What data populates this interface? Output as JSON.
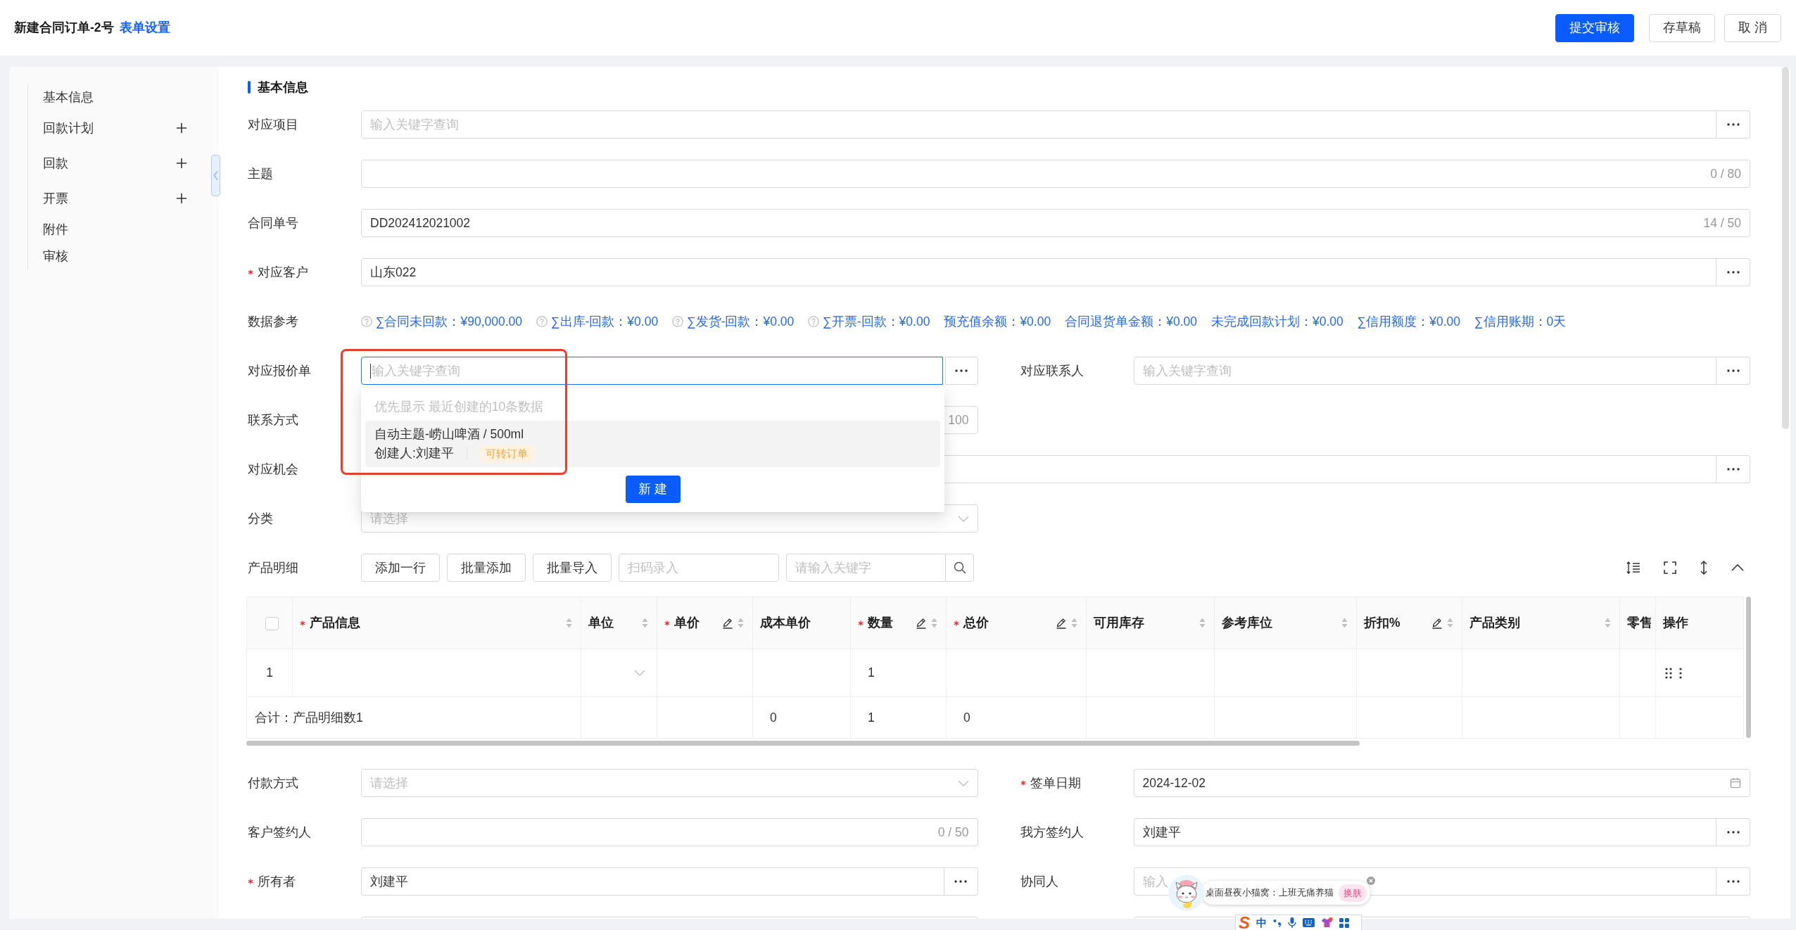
{
  "header": {
    "title": "新建合同订单-2号",
    "settings_link": "表单设置",
    "buttons": [
      {
        "label": "提交审核",
        "kind": "primary"
      },
      {
        "label": "存草稿",
        "kind": "default"
      },
      {
        "label": "取 消",
        "kind": "default"
      }
    ]
  },
  "sidebar": {
    "items": [
      {
        "label": "基本信息",
        "addable": false
      },
      {
        "label": "回款计划",
        "addable": true
      },
      {
        "label": "回款",
        "addable": true
      },
      {
        "label": "开票",
        "addable": true
      },
      {
        "label": "附件",
        "addable": false
      },
      {
        "label": "审核",
        "addable": false
      }
    ]
  },
  "section": {
    "title": "基本信息"
  },
  "form_top": [
    {
      "kind": "full",
      "field": {
        "label": "对应项目",
        "kind": "lookup",
        "required": false,
        "focused": false,
        "placeholder": "输入关键字查询"
      }
    },
    {
      "kind": "full",
      "field": {
        "label": "主题",
        "kind": "text",
        "required": false,
        "focused": false,
        "counter": "0 / 80"
      }
    },
    {
      "kind": "full",
      "field": {
        "label": "合同单号",
        "kind": "text",
        "required": false,
        "focused": false,
        "value": "DD202412021002",
        "counter": "14 / 50"
      }
    },
    {
      "kind": "full",
      "field": {
        "label": "对应客户",
        "kind": "lookup",
        "required": true,
        "focused": false,
        "value": "山东022"
      }
    },
    {
      "kind": "reference",
      "label": "数据参考",
      "items": [
        {
          "text": "∑合同未回款：¥90,000.00",
          "help": true
        },
        {
          "text": "∑出库-回款：¥0.00",
          "help": true
        },
        {
          "text": "∑发货-回款：¥0.00",
          "help": true
        },
        {
          "text": "∑开票-回款：¥0.00",
          "help": true
        },
        {
          "text": "预充值余额：¥0.00",
          "help": false
        },
        {
          "text": "合同退货单金额：¥0.00",
          "help": false
        },
        {
          "text": "未完成回款计划：¥0.00",
          "help": false
        },
        {
          "text": "∑信用额度：¥0.00",
          "help": false
        },
        {
          "text": "∑信用账期：0天",
          "help": false
        }
      ]
    },
    {
      "kind": "pair",
      "fields": [
        {
          "label": "对应报价单",
          "kind": "lookup",
          "required": false,
          "focused": true,
          "placeholder": "输入关键字查询",
          "dropdown": {
            "highlighted": true,
            "hint": "优先显示 最近创建的10条数据",
            "options": [
              {
                "title": "自动主题-崂山啤酒 / 500ml",
                "creator": "创建人:刘建平",
                "tag": "可转订单",
                "selected": true
              }
            ],
            "button": "新 建"
          }
        },
        {
          "label": "对应联系人",
          "kind": "lookup",
          "required": false,
          "focused": false,
          "placeholder": "输入关键字查询"
        }
      ]
    },
    {
      "kind": "pair",
      "fields": [
        {
          "label": "联系方式",
          "kind": "text",
          "required": false,
          "focused": false,
          "counter": "100"
        }
      ]
    },
    {
      "kind": "full",
      "field": {
        "label": "对应机会",
        "kind": "lookup",
        "required": false,
        "focused": false
      }
    },
    {
      "kind": "pair",
      "fields": [
        {
          "label": "分类",
          "kind": "select",
          "required": false,
          "focused": false,
          "placeholder": "请选择"
        }
      ]
    }
  ],
  "products": {
    "label": "产品明细",
    "buttons": [
      "添加一行",
      "批量添加",
      "批量导入"
    ],
    "scan_placeholder": "扫码录入",
    "search_placeholder": "请输入关键字",
    "table": {
      "select_all": {
        "checked": false
      },
      "columns": [
        {
          "label": "产品信息",
          "required": true,
          "editable": false,
          "sortable": true
        },
        {
          "label": "单位",
          "required": false,
          "editable": false,
          "sortable": true
        },
        {
          "label": "单价",
          "required": true,
          "editable": true,
          "sortable": true
        },
        {
          "label": "成本单价",
          "required": false,
          "editable": false,
          "sortable": false
        },
        {
          "label": "数量",
          "required": true,
          "editable": true,
          "sortable": true
        },
        {
          "label": "总价",
          "required": true,
          "editable": true,
          "sortable": true
        },
        {
          "label": "可用库存",
          "required": false,
          "editable": false,
          "sortable": true
        },
        {
          "label": "参考库位",
          "required": false,
          "editable": false,
          "sortable": true
        },
        {
          "label": "折扣%",
          "required": false,
          "editable": true,
          "sortable": true
        },
        {
          "label": "产品类别",
          "required": false,
          "editable": false,
          "sortable": true
        },
        {
          "label": "零售",
          "required": false,
          "editable": false,
          "sortable": false
        },
        {
          "label": "操作",
          "required": false,
          "editable": false,
          "sortable": false
        }
      ],
      "rows": [
        {
          "number": "1",
          "cells": [
            {
              "kind": "empty"
            },
            {
              "kind": "select"
            },
            {
              "kind": "empty"
            },
            {
              "kind": "empty"
            },
            {
              "kind": "text",
              "text": "1"
            },
            {
              "kind": "empty"
            },
            {
              "kind": "empty"
            },
            {
              "kind": "empty"
            },
            {
              "kind": "empty"
            },
            {
              "kind": "empty"
            },
            {
              "kind": "empty"
            },
            {
              "kind": "actions"
            }
          ]
        }
      ],
      "summary": {
        "label": "合计：产品明细数1",
        "cells": [
          {
            "kind": "empty"
          },
          {
            "kind": "empty"
          },
          {
            "kind": "text",
            "text": "0"
          },
          {
            "kind": "text",
            "text": "1"
          },
          {
            "kind": "text",
            "text": "0"
          },
          {
            "kind": "empty"
          },
          {
            "kind": "empty"
          },
          {
            "kind": "empty"
          },
          {
            "kind": "empty"
          },
          {
            "kind": "empty"
          },
          {
            "kind": "empty"
          }
        ]
      }
    }
  },
  "form_bottom": [
    {
      "kind": "pair",
      "fields": [
        {
          "label": "付款方式",
          "kind": "select",
          "required": false,
          "focused": false,
          "placeholder": "请选择"
        },
        {
          "label": "签单日期",
          "kind": "date",
          "required": true,
          "focused": false,
          "value": "2024-12-02"
        }
      ]
    },
    {
      "kind": "pair",
      "fields": [
        {
          "label": "客户签约人",
          "kind": "text",
          "required": false,
          "focused": false,
          "counter": "0 / 50"
        },
        {
          "label": "我方签约人",
          "kind": "lookup",
          "required": false,
          "focused": false,
          "value": "刘建平"
        }
      ]
    },
    {
      "kind": "pair",
      "fields": [
        {
          "label": "所有者",
          "kind": "lookup",
          "required": true,
          "focused": false,
          "value": "刘建平"
        },
        {
          "label": "协同人",
          "kind": "lookup",
          "required": false,
          "focused": false,
          "placeholder": "输入"
        }
      ]
    },
    {
      "kind": "pair",
      "fields": [
        {
          "kind": "text",
          "required": false,
          "focused": false
        },
        {
          "kind": "text",
          "required": false,
          "focused": false
        }
      ]
    }
  ],
  "desktop_pet": {
    "caption": "桌面昼夜小猫窝：上班无痛养猫",
    "button": "换肤"
  },
  "ime_toolbar": {
    "logo": "S",
    "mode": "中"
  }
}
